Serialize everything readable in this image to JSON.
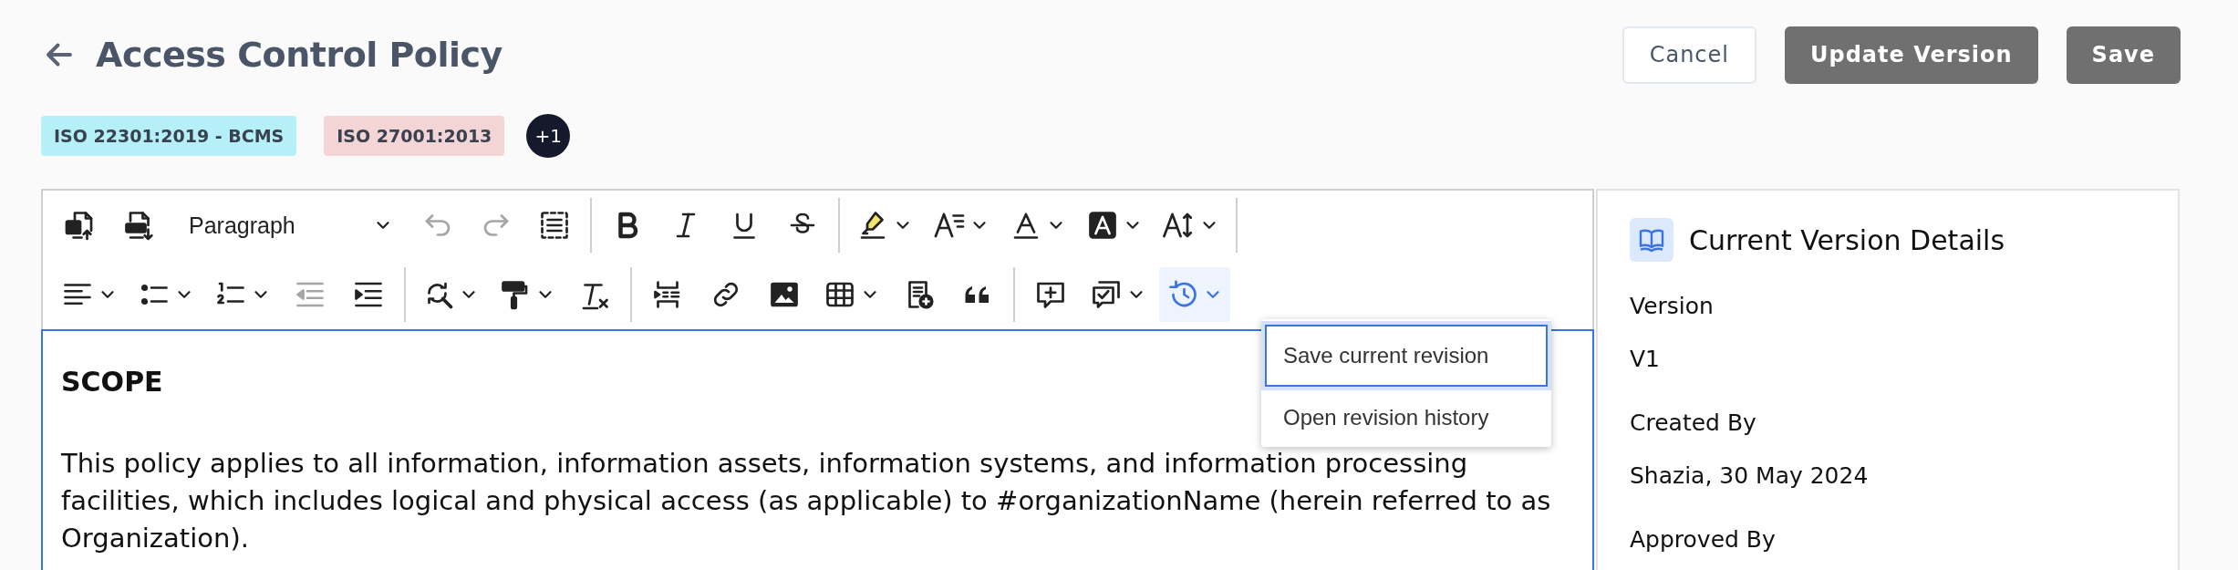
{
  "header": {
    "title": "Access Control Policy",
    "buttons": [
      {
        "label": "Cancel",
        "kind": "secondary"
      },
      {
        "label": "Update Version",
        "kind": "primary"
      },
      {
        "label": "Save",
        "kind": "primary"
      }
    ]
  },
  "tags": [
    {
      "label": "ISO 22301:2019 - BCMS",
      "color": "#b5f0f8"
    },
    {
      "label": "ISO 27001:2013",
      "color": "#f3d5d5"
    }
  ],
  "more_tags": "+1",
  "toolbar": {
    "rows": [
      [
        {
          "kind": "word",
          "menu": false,
          "disabled": false,
          "active": false
        },
        {
          "kind": "pdf",
          "menu": false,
          "disabled": false,
          "active": false
        },
        {
          "kind": "style",
          "label": "Paragraph",
          "menu": true,
          "disabled": false,
          "active": false
        },
        {
          "kind": "undo",
          "menu": false,
          "disabled": true,
          "active": false
        },
        {
          "kind": "redo",
          "menu": false,
          "disabled": true,
          "active": false
        },
        {
          "kind": "selectall",
          "menu": false,
          "disabled": false,
          "active": false
        },
        {
          "kind": "separator"
        },
        {
          "kind": "bold",
          "menu": false,
          "disabled": false,
          "active": false
        },
        {
          "kind": "italic",
          "menu": false,
          "disabled": false,
          "active": false
        },
        {
          "kind": "underline",
          "menu": false,
          "disabled": false,
          "active": false
        },
        {
          "kind": "strike",
          "menu": false,
          "disabled": false,
          "active": false
        },
        {
          "kind": "separator"
        },
        {
          "kind": "highlight",
          "menu": true,
          "disabled": false,
          "active": false
        },
        {
          "kind": "fontsize",
          "menu": true,
          "disabled": false,
          "active": false
        },
        {
          "kind": "fontcolor",
          "menu": true,
          "disabled": false,
          "active": false
        },
        {
          "kind": "bgcolor",
          "menu": true,
          "disabled": false,
          "active": false
        },
        {
          "kind": "lineheight",
          "menu": true,
          "disabled": false,
          "active": false
        },
        {
          "kind": "separator"
        }
      ],
      [
        {
          "kind": "align",
          "menu": true,
          "disabled": false,
          "active": false
        },
        {
          "kind": "bullets",
          "menu": true,
          "disabled": false,
          "active": false
        },
        {
          "kind": "numbered",
          "menu": true,
          "disabled": false,
          "active": false
        },
        {
          "kind": "outdent",
          "menu": false,
          "disabled": true,
          "active": false
        },
        {
          "kind": "indent",
          "menu": false,
          "disabled": false,
          "active": false
        },
        {
          "kind": "separator"
        },
        {
          "kind": "find",
          "menu": true,
          "disabled": false,
          "active": false
        },
        {
          "kind": "paint",
          "menu": true,
          "disabled": false,
          "active": false
        },
        {
          "kind": "clearformat",
          "menu": false,
          "disabled": false,
          "active": false
        },
        {
          "kind": "separator"
        },
        {
          "kind": "pagebreak",
          "menu": false,
          "disabled": false,
          "active": false
        },
        {
          "kind": "link",
          "menu": false,
          "disabled": false,
          "active": false
        },
        {
          "kind": "image",
          "menu": false,
          "disabled": false,
          "active": false
        },
        {
          "kind": "table",
          "menu": true,
          "disabled": false,
          "active": false
        },
        {
          "kind": "template",
          "menu": false,
          "disabled": false,
          "active": false
        },
        {
          "kind": "quote",
          "menu": false,
          "disabled": false,
          "active": false
        },
        {
          "kind": "separator"
        },
        {
          "kind": "comment",
          "menu": false,
          "disabled": false,
          "active": false
        },
        {
          "kind": "comments",
          "menu": true,
          "disabled": false,
          "active": false
        },
        {
          "kind": "history",
          "menu": true,
          "disabled": false,
          "active": true
        }
      ]
    ]
  },
  "revision_menu": {
    "items": [
      {
        "label": "Save current revision",
        "selected": true
      },
      {
        "label": "Open revision history",
        "selected": false
      }
    ]
  },
  "document": {
    "heading": "SCOPE",
    "paragraph": "This policy applies to all information, information assets, information systems, and information processing facilities, which includes logical and physical access (as applicable) to #organizationName (herein referred to as Organization)."
  },
  "details": {
    "title": "Current Version Details",
    "fields": [
      {
        "label": "Version",
        "value": "V1"
      },
      {
        "label": "Created By",
        "value": "Shazia, 30 May 2024"
      },
      {
        "label": "Approved By"
      }
    ]
  }
}
